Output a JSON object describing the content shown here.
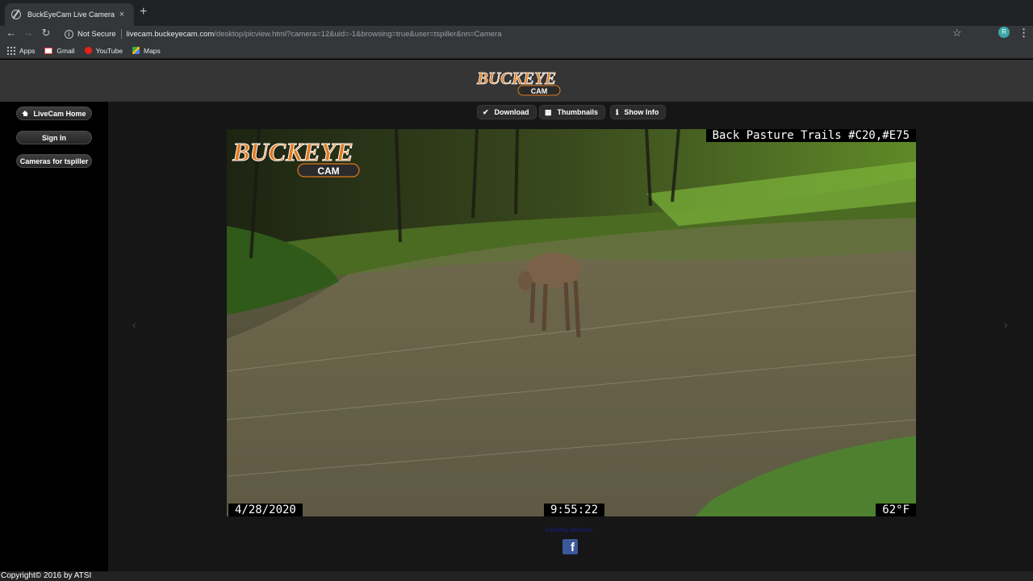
{
  "browser": {
    "tab_title": "BuckEyeCam Live Camera",
    "tab_close": "×",
    "new_tab": "+",
    "back": "←",
    "forward": "→",
    "reload": "↻",
    "security_label": "Not Secure",
    "url_host": "livecam.buckeyecam.com",
    "url_path": "/desktop/picview.html?camera=12&uid=-1&browsing=true&user=tspiller&nn=Camera",
    "star": "☆",
    "profile_initial": "R",
    "menu": "⋮",
    "bookmarks": [
      {
        "label": "Apps",
        "icon": "apps-grid-icon"
      },
      {
        "label": "Gmail",
        "icon": "gmail-icon"
      },
      {
        "label": "YouTube",
        "icon": "youtube-icon"
      },
      {
        "label": "Maps",
        "icon": "maps-icon"
      }
    ]
  },
  "site": {
    "logo_text_top": "BUCKEYE",
    "logo_text_bottom": "CAM",
    "sidebar": {
      "home": "LiveCam Home",
      "sign_in": "Sign In",
      "cameras": "Cameras for tspiller"
    },
    "actions": {
      "download": "Download",
      "thumbnails": "Thumbnails",
      "show_info": "Show Info"
    },
    "photo": {
      "camera_label": "Back Pasture Trails #C20,#E75",
      "date": "4/28/2020",
      "time": "9:55:22",
      "temperature": "62°F",
      "watermark_top": "BUCKEYE",
      "watermark_bottom": "CAM"
    },
    "prev_arrow": "‹",
    "next_arrow": "›",
    "footer_link": "Loading pictures.",
    "facebook": "f",
    "copyright": "Copyright© 2016 by ATSI"
  },
  "colors": {
    "accent_orange": "#e07a1f",
    "facebook_blue": "#3b5998"
  }
}
